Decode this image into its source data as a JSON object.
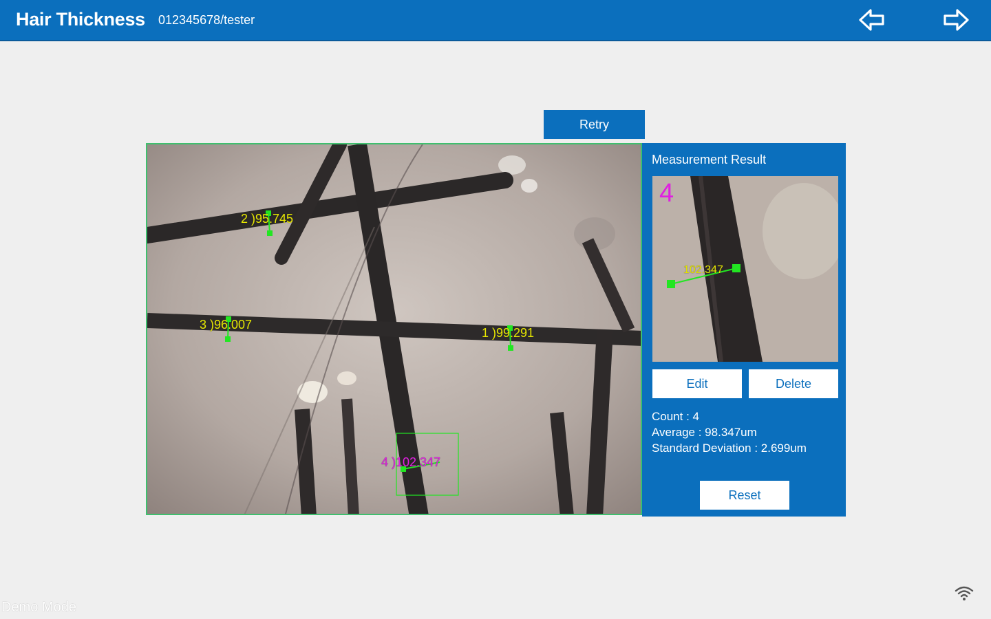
{
  "header": {
    "title": "Hair Thickness",
    "user": "012345678/tester",
    "back_icon": "arrow-left-icon",
    "forward_icon": "arrow-right-icon"
  },
  "retry_label": "Retry",
  "image": {
    "scale_line1": "",
    "scale_line2": "",
    "measurements": [
      {
        "label": "1 )99.291"
      },
      {
        "label": "2 )95.745"
      },
      {
        "label": "3 )96.007"
      },
      {
        "label": "4 )102.347"
      }
    ]
  },
  "result": {
    "title": "Measurement Result",
    "index": "4",
    "value": "102.347",
    "edit_label": "Edit",
    "delete_label": "Delete",
    "count": "Count : 4",
    "average": "Average : 98.347um",
    "std_dev": "Standard Deviation : 2.699um",
    "reset_label": "Reset"
  },
  "status": {
    "wifi_icon": "wifi-icon",
    "demo_mode": "Demo Mode"
  },
  "colors": {
    "brand": "#0b6fbd",
    "measure_line": "#22e622",
    "measure_text": "#e6e600",
    "active_measure": "#e020e0"
  }
}
